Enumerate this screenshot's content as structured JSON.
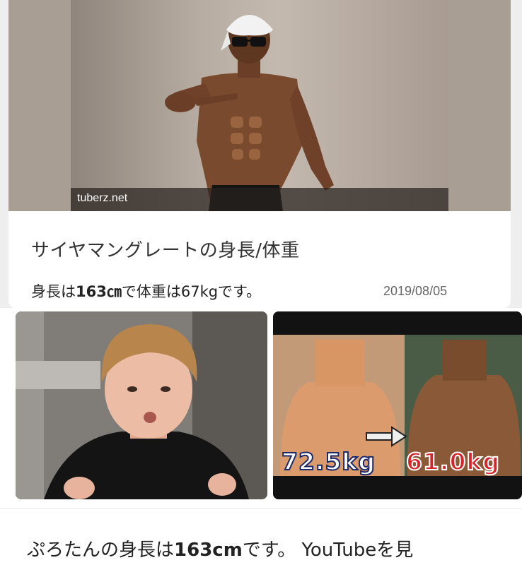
{
  "result1": {
    "source": "tuberz.net",
    "title": "サイヤマングレートの身長/体重",
    "snippet_pre": "身長は",
    "snippet_height": "163㎝",
    "snippet_post": "で体重は67kgです。",
    "date": "2019/08/05"
  },
  "result2": {
    "weight_before": "72.5kg",
    "weight_after": "61.0kg",
    "title_pre": "ぷろたんの身長は",
    "title_height": "163cm",
    "title_post": "です。 YouTubeを見"
  },
  "colors": {
    "background": "#eeeeee",
    "card": "#ffffff",
    "weight_before": "#ffffff",
    "weight_after": "#d8232a"
  }
}
